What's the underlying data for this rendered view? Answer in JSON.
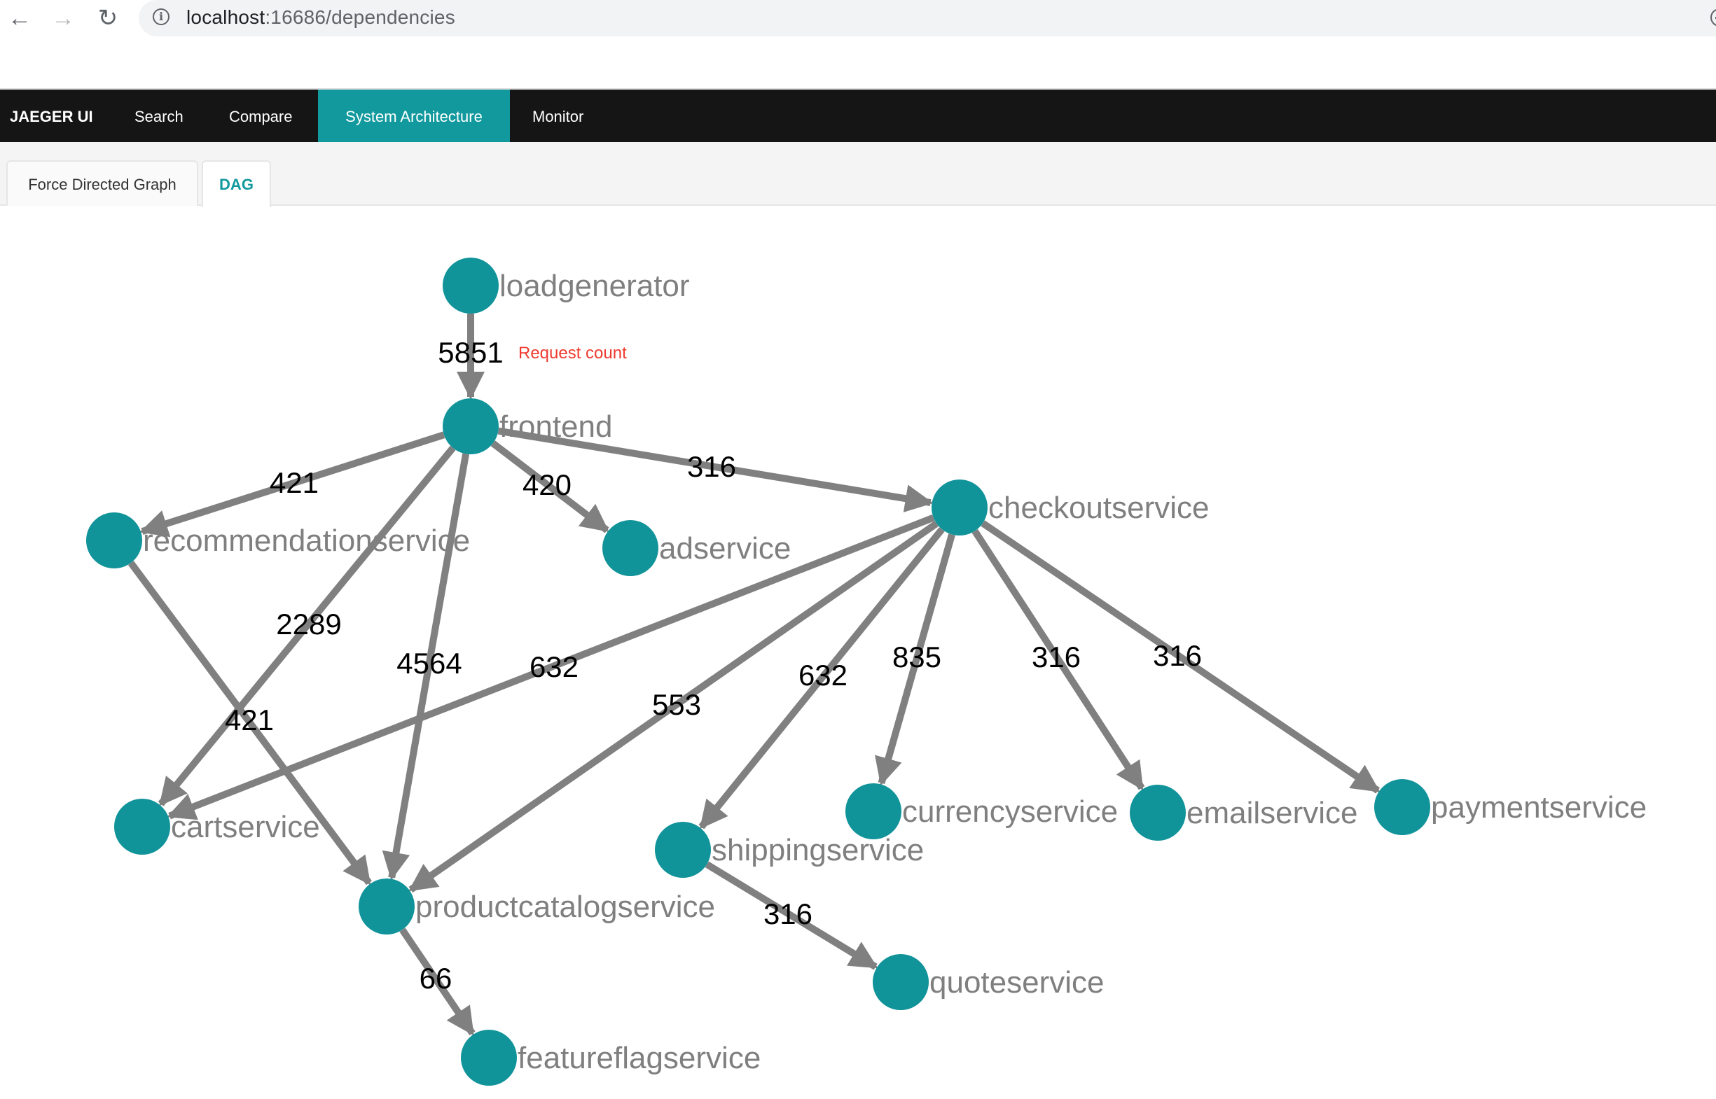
{
  "browser": {
    "back_icon": "arrow-left-icon",
    "forward_icon": "arrow-right-icon",
    "reload_icon": "reload-icon",
    "info_icon": "info-icon",
    "url_host": "localhost",
    "url_rest": ":16686/dependencies",
    "zoom_icon": "zoom-out-icon"
  },
  "nav": {
    "brand": "JAEGER UI",
    "items": [
      {
        "label": "Search",
        "active": false
      },
      {
        "label": "Compare",
        "active": false
      },
      {
        "label": "System Architecture",
        "active": true
      },
      {
        "label": "Monitor",
        "active": false
      }
    ]
  },
  "tabs": [
    {
      "label": "Force Directed Graph",
      "active": false
    },
    {
      "label": "DAG",
      "active": true
    }
  ],
  "colors": {
    "accent": "#11999e",
    "node": "#11939a",
    "edge": "#808080",
    "node_label": "#7f7f7f",
    "edge_label": "#000000",
    "annotation": "#ef3b30"
  },
  "annotation": "Request count",
  "graph": {
    "nodes": [
      {
        "id": "loadgenerator"
      },
      {
        "id": "frontend"
      },
      {
        "id": "recommendationservice"
      },
      {
        "id": "adservice"
      },
      {
        "id": "checkoutservice"
      },
      {
        "id": "cartservice"
      },
      {
        "id": "productcatalogservice"
      },
      {
        "id": "shippingservice"
      },
      {
        "id": "currencyservice"
      },
      {
        "id": "emailservice"
      },
      {
        "id": "paymentservice"
      },
      {
        "id": "quoteservice"
      },
      {
        "id": "featureflagservice"
      }
    ],
    "edges": [
      {
        "source": "loadgenerator",
        "target": "frontend",
        "count": 5851
      },
      {
        "source": "frontend",
        "target": "recommendationservice",
        "count": 421
      },
      {
        "source": "frontend",
        "target": "adservice",
        "count": 420
      },
      {
        "source": "frontend",
        "target": "checkoutservice",
        "count": 316
      },
      {
        "source": "frontend",
        "target": "cartservice",
        "count": 2289
      },
      {
        "source": "frontend",
        "target": "productcatalogservice",
        "count": 4564
      },
      {
        "source": "recommendationservice",
        "target": "productcatalogservice",
        "count": 421
      },
      {
        "source": "checkoutservice",
        "target": "cartservice",
        "count": 632
      },
      {
        "source": "checkoutservice",
        "target": "productcatalogservice",
        "count": 553
      },
      {
        "source": "checkoutservice",
        "target": "shippingservice",
        "count": 632
      },
      {
        "source": "checkoutservice",
        "target": "currencyservice",
        "count": 835
      },
      {
        "source": "checkoutservice",
        "target": "emailservice",
        "count": 316
      },
      {
        "source": "checkoutservice",
        "target": "paymentservice",
        "count": 316
      },
      {
        "source": "shippingservice",
        "target": "quoteservice",
        "count": 316
      },
      {
        "source": "productcatalogservice",
        "target": "featureflagservice",
        "count": 66
      }
    ]
  }
}
